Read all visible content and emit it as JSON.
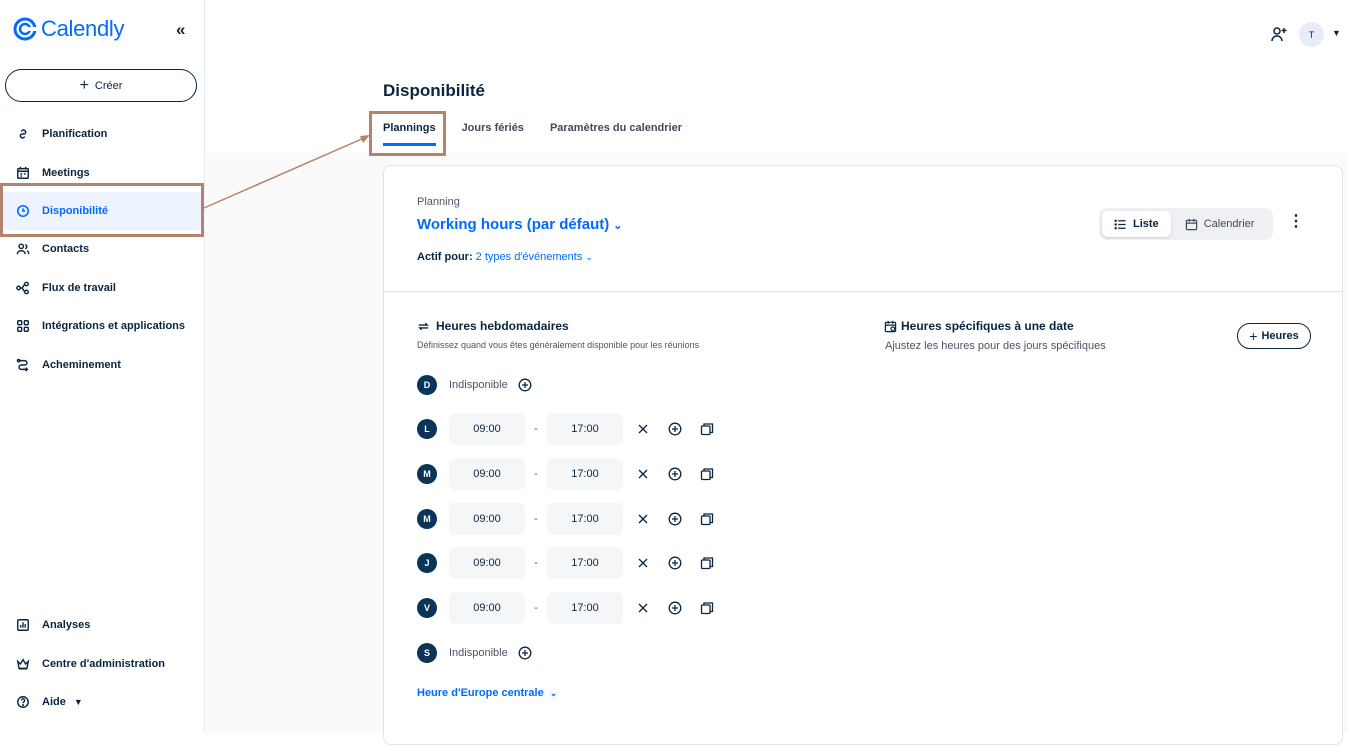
{
  "app": {
    "name": "Calendly"
  },
  "sidebar": {
    "create_label": "Créer",
    "items": [
      {
        "label": "Planification",
        "icon": "link-icon"
      },
      {
        "label": "Meetings",
        "icon": "calendar-icon"
      },
      {
        "label": "Disponibilité",
        "icon": "clock-icon",
        "active": true
      },
      {
        "label": "Contacts",
        "icon": "users-icon"
      },
      {
        "label": "Flux de travail",
        "icon": "workflow-icon"
      },
      {
        "label": "Intégrations et applications",
        "icon": "grid-icon"
      },
      {
        "label": "Acheminement",
        "icon": "routing-icon"
      }
    ],
    "bottom_items": [
      {
        "label": "Analyses",
        "icon": "chart-icon"
      },
      {
        "label": "Centre d'administration",
        "icon": "crown-icon"
      },
      {
        "label": "Aide",
        "icon": "help-icon"
      }
    ]
  },
  "header": {
    "avatar_initial": "T"
  },
  "page": {
    "title": "Disponibilité",
    "tabs": [
      {
        "label": "Plannings",
        "active": true
      },
      {
        "label": "Jours fériés"
      },
      {
        "label": "Paramètres du calendrier"
      }
    ]
  },
  "schedule": {
    "label": "Planning",
    "name": "Working hours (par défaut)",
    "active_for_label": "Actif pour:",
    "active_for_value": "2 types d'événements",
    "view_list": "Liste",
    "view_calendar": "Calendrier"
  },
  "weekly": {
    "title": "Heures hebdomadaires",
    "subtitle": "Définissez quand vous êtes généralement disponible pour les réunions",
    "unavailable_label": "Indisponible",
    "days": [
      {
        "letter": "D",
        "available": false
      },
      {
        "letter": "L",
        "available": true,
        "start": "09:00",
        "end": "17:00"
      },
      {
        "letter": "M",
        "available": true,
        "start": "09:00",
        "end": "17:00"
      },
      {
        "letter": "M",
        "available": true,
        "start": "09:00",
        "end": "17:00"
      },
      {
        "letter": "J",
        "available": true,
        "start": "09:00",
        "end": "17:00"
      },
      {
        "letter": "V",
        "available": true,
        "start": "09:00",
        "end": "17:00"
      },
      {
        "letter": "S",
        "available": false
      }
    ],
    "timezone": "Heure d'Europe centrale"
  },
  "date_specific": {
    "title": "Heures spécifiques à une date",
    "subtitle": "Ajustez les heures pour des jours spécifiques",
    "button_label": "Heures"
  },
  "colors": {
    "brand": "#006bff",
    "navy": "#0a2540",
    "annotation": "#b5836b"
  }
}
